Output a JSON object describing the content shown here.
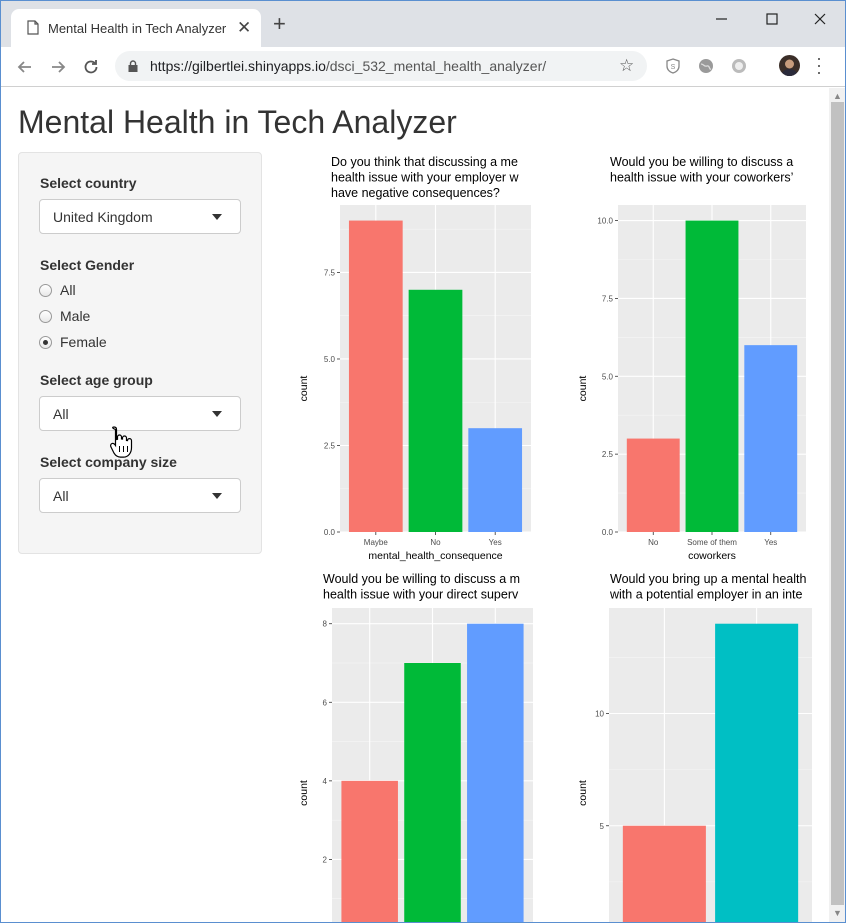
{
  "browser": {
    "tab_title": "Mental Health in Tech Analyzer",
    "url_host": "https://gilbertlei.shinyapps.io",
    "url_path": "/dsci_532_mental_health_analyzer/"
  },
  "page": {
    "title": "Mental Health in Tech Analyzer"
  },
  "sidebar": {
    "country_label": "Select country",
    "country_value": "United Kingdom",
    "gender_label": "Select Gender",
    "gender_options": [
      {
        "label": "All",
        "selected": false
      },
      {
        "label": "Male",
        "selected": false
      },
      {
        "label": "Female",
        "selected": true
      }
    ],
    "age_label": "Select age group",
    "age_value": "All",
    "company_label": "Select company size",
    "company_value": "All"
  },
  "colors": {
    "red": "#F8766D",
    "green": "#00BA38",
    "blue": "#619CFF",
    "teal": "#00BFC4",
    "panel_bg": "#EBEBEB"
  },
  "chart_data": [
    {
      "type": "bar",
      "title": [
        "Do you think that discussing a me",
        "health issue with your employer w",
        "have negative consequences?"
      ],
      "xlabel": "mental_health_consequence",
      "ylabel": "count",
      "categories": [
        "Maybe",
        "No",
        "Yes"
      ],
      "values": [
        9,
        7,
        3
      ],
      "colors": [
        "#F8766D",
        "#00BA38",
        "#619CFF"
      ],
      "ylim": [
        0,
        9.45
      ],
      "ticks": [
        0,
        2.5,
        5,
        7.5
      ],
      "tick_labels": [
        "0.0",
        "2.5",
        "5.0",
        "7.5"
      ]
    },
    {
      "type": "bar",
      "title": [
        "Would you be willing to discuss a",
        "health issue with your coworkers’"
      ],
      "xlabel": "coworkers",
      "ylabel": "count",
      "categories": [
        "No",
        "Some of them",
        "Yes"
      ],
      "values": [
        3,
        10,
        6
      ],
      "colors": [
        "#F8766D",
        "#00BA38",
        "#619CFF"
      ],
      "ylim": [
        0,
        10.5
      ],
      "ticks": [
        0,
        2.5,
        5,
        7.5,
        10
      ],
      "tick_labels": [
        "0.0",
        "2.5",
        "5.0",
        "7.5",
        "10.0"
      ]
    },
    {
      "type": "bar",
      "title": [
        "Would you be willing to discuss a m",
        "health issue with your direct superv"
      ],
      "xlabel": "",
      "ylabel": "count",
      "categories": [
        "",
        "",
        ""
      ],
      "values": [
        4,
        7,
        8
      ],
      "colors": [
        "#F8766D",
        "#00BA38",
        "#619CFF"
      ],
      "ylim": [
        0,
        8.4
      ],
      "ticks": [
        2,
        4,
        6,
        8
      ],
      "tick_labels": [
        "2",
        "4",
        "6",
        "8"
      ]
    },
    {
      "type": "bar",
      "title": [
        "Would you bring up a mental health",
        "with a potential employer in an inte"
      ],
      "xlabel": "",
      "ylabel": "count",
      "categories": [
        "",
        ""
      ],
      "values": [
        5,
        14
      ],
      "colors": [
        "#F8766D",
        "#00BFC4"
      ],
      "ylim": [
        0,
        14.7
      ],
      "ticks": [
        5,
        10
      ],
      "tick_labels": [
        "5",
        "10"
      ]
    }
  ]
}
